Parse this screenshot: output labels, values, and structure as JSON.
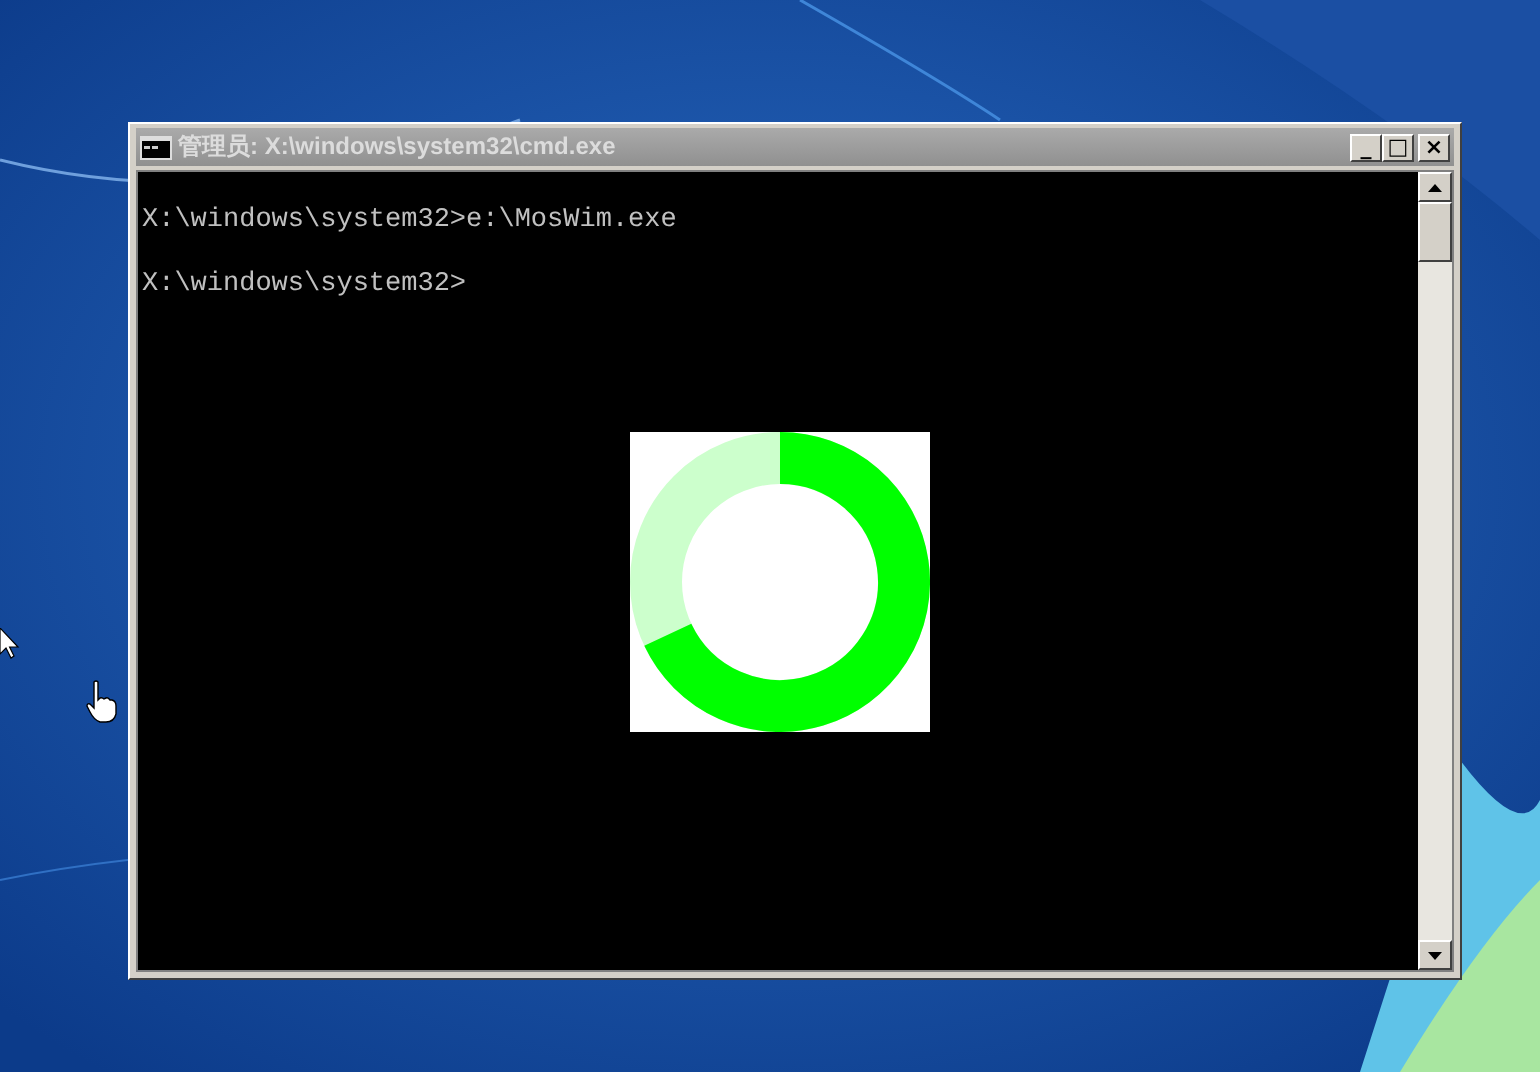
{
  "window": {
    "title": "管理员: X:\\windows\\system32\\cmd.exe",
    "controls": [
      "_",
      "□",
      "×"
    ]
  },
  "console": {
    "lines": [
      "X:\\windows\\system32>e:\\MosWim.exe",
      "X:\\windows\\system32>"
    ]
  }
}
